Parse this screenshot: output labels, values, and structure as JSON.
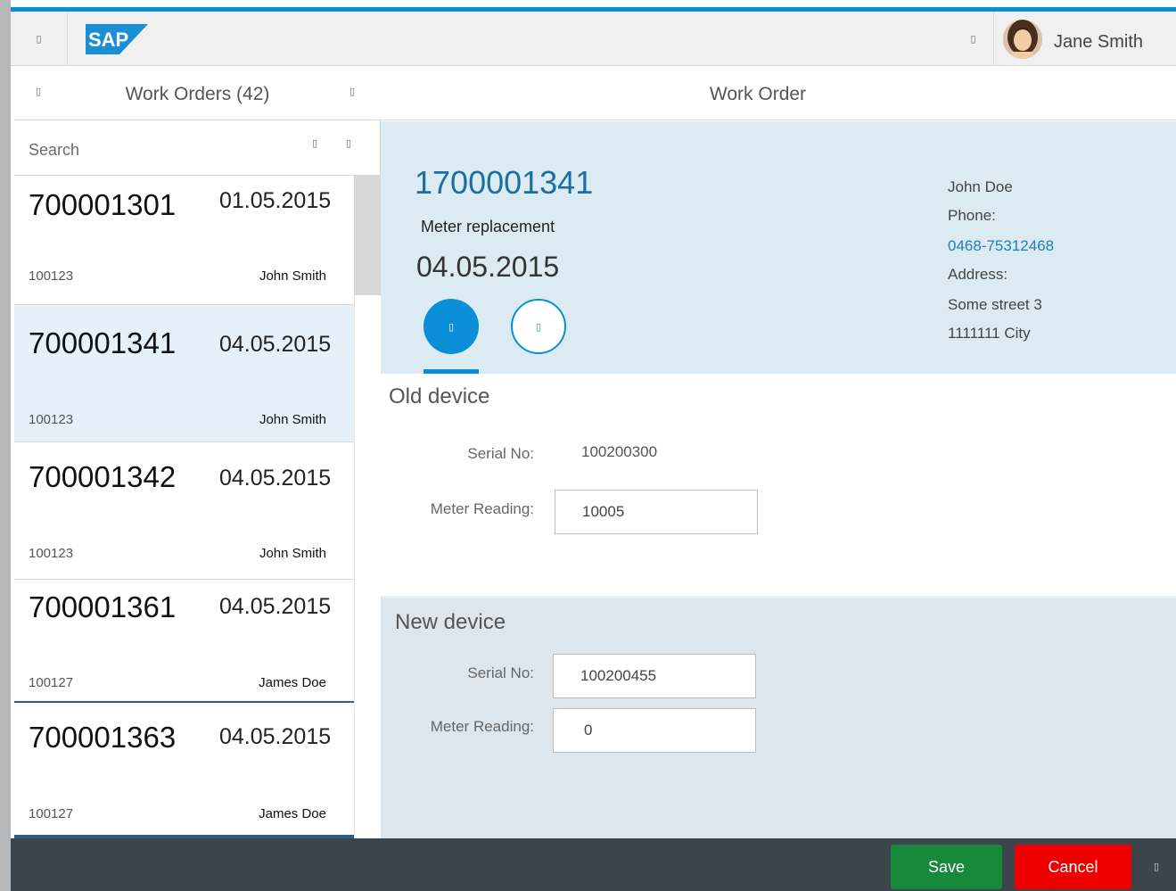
{
  "shell": {
    "logo_text": "SAP",
    "user_name": "Jane Smith",
    "icons": {
      "menu": "missing-glyph-icon",
      "notifications": "missing-glyph-icon"
    },
    "colors": {
      "accent": "#0a8fd6",
      "logo": "#1a8fd6"
    }
  },
  "glyph": "▯",
  "master": {
    "title": "Work Orders (42)",
    "search_placeholder": "Search",
    "items": [
      {
        "number": "700001301",
        "date": "01.05.2015",
        "code": "100123",
        "name": "John Smith",
        "selected": false
      },
      {
        "number": "700001341",
        "date": "04.05.2015",
        "code": "100123",
        "name": "John Smith",
        "selected": true
      },
      {
        "number": "700001342",
        "date": "04.05.2015",
        "code": "100123",
        "name": "John Smith",
        "selected": false
      },
      {
        "number": "700001361",
        "date": "04.05.2015",
        "code": "100127",
        "name": "James Doe",
        "selected": false
      },
      {
        "number": "700001363",
        "date": "04.05.2015",
        "code": "100127",
        "name": "James Doe",
        "selected": false
      }
    ]
  },
  "detail": {
    "title": "Work Order",
    "order_number": "1700001341",
    "order_type": "Meter replacement",
    "order_date": "04.05.2015",
    "contact": {
      "name": "John Doe",
      "phone_label": "Phone:",
      "phone": "0468-75312468",
      "address_label": "Address:",
      "street": "Some street 3",
      "city": "1111111 City"
    },
    "old_device": {
      "title": "Old device",
      "serial_label": "Serial No:",
      "serial_value": "100200300",
      "reading_label": "Meter Reading:",
      "reading_value": "10005"
    },
    "new_device": {
      "title": "New device",
      "serial_label": "Serial No:",
      "serial_value": "100200455",
      "reading_label": "Meter Reading:",
      "reading_value": "0"
    }
  },
  "footer": {
    "save_label": "Save",
    "cancel_label": "Cancel",
    "colors": {
      "save": "#168a3a",
      "cancel": "#ee0000"
    }
  }
}
